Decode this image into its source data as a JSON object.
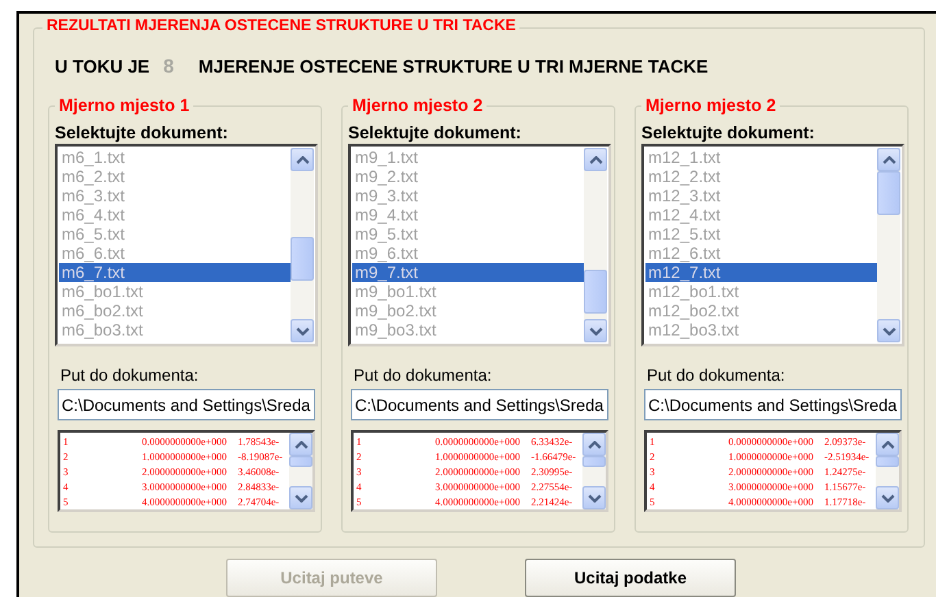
{
  "frame": {
    "title": "REZULTATI MJERENJA OSTECENE STRUKTURE U TRI TACKE"
  },
  "status": {
    "prefix": "U TOKU JE",
    "count": "8",
    "suffix": "MJERENJE OSTECENE STRUKTURE U TRI MJERNE TACKE"
  },
  "panels": [
    {
      "title": "Mjerno mjesto 1",
      "list_label": "Selektujte dokument:",
      "files": [
        {
          "label": "m6_1.txt",
          "selected": false
        },
        {
          "label": "m6_2.txt",
          "selected": false
        },
        {
          "label": "m6_3.txt",
          "selected": false
        },
        {
          "label": "m6_4.txt",
          "selected": false
        },
        {
          "label": "m6_5.txt",
          "selected": false
        },
        {
          "label": "m6_6.txt",
          "selected": false
        },
        {
          "label": "m6_7.txt",
          "selected": true
        },
        {
          "label": "m6_bo1.txt",
          "selected": false
        },
        {
          "label": "m6_bo2.txt",
          "selected": false
        },
        {
          "label": "m6_bo3.txt",
          "selected": false
        }
      ],
      "path_label": "Put do dokumenta:",
      "path": "C:\\Documents and Settings\\Sreda",
      "rows": [
        [
          "1",
          "0.0000000000e+000",
          "1.78543e-"
        ],
        [
          "2",
          "1.0000000000e+000",
          "-8.19087e-"
        ],
        [
          "3",
          "2.0000000000e+000",
          "3.46008e-"
        ],
        [
          "4",
          "3.0000000000e+000",
          "2.84833e-"
        ],
        [
          "5",
          "4.0000000000e+000",
          "2.74704e-"
        ]
      ]
    },
    {
      "title": "Mjerno mjesto 2",
      "list_label": "Selektujte dokument:",
      "files": [
        {
          "label": "m9_1.txt",
          "selected": false
        },
        {
          "label": "m9_2.txt",
          "selected": false
        },
        {
          "label": "m9_3.txt",
          "selected": false
        },
        {
          "label": "m9_4.txt",
          "selected": false
        },
        {
          "label": "m9_5.txt",
          "selected": false
        },
        {
          "label": "m9_6.txt",
          "selected": false
        },
        {
          "label": "m9_7.txt",
          "selected": true
        },
        {
          "label": "m9_bo1.txt",
          "selected": false
        },
        {
          "label": "m9_bo2.txt",
          "selected": false
        },
        {
          "label": "m9_bo3.txt",
          "selected": false
        }
      ],
      "path_label": "Put do dokumenta:",
      "path": "C:\\Documents and Settings\\Sreda",
      "rows": [
        [
          "1",
          "0.0000000000e+000",
          "6.33432e-"
        ],
        [
          "2",
          "1.0000000000e+000",
          "-1.66479e-"
        ],
        [
          "3",
          "2.0000000000e+000",
          "2.30995e-"
        ],
        [
          "4",
          "3.0000000000e+000",
          "2.27554e-"
        ],
        [
          "5",
          "4.0000000000e+000",
          "2.21424e-"
        ]
      ]
    },
    {
      "title": "Mjerno mjesto 2",
      "list_label": "Selektujte dokument:",
      "files": [
        {
          "label": "m12_1.txt",
          "selected": false
        },
        {
          "label": "m12_2.txt",
          "selected": false
        },
        {
          "label": "m12_3.txt",
          "selected": false
        },
        {
          "label": "m12_4.txt",
          "selected": false
        },
        {
          "label": "m12_5.txt",
          "selected": false
        },
        {
          "label": "m12_6.txt",
          "selected": false
        },
        {
          "label": "m12_7.txt",
          "selected": true
        },
        {
          "label": "m12_bo1.txt",
          "selected": false
        },
        {
          "label": "m12_bo2.txt",
          "selected": false
        },
        {
          "label": "m12_bo3.txt",
          "selected": false
        }
      ],
      "path_label": "Put do dokumenta:",
      "path": "C:\\Documents and Settings\\Sreda",
      "rows": [
        [
          "1",
          "0.0000000000e+000",
          "2.09373e-"
        ],
        [
          "2",
          "1.0000000000e+000",
          "-2.51934e-"
        ],
        [
          "3",
          "2.0000000000e+000",
          "1.24275e-"
        ],
        [
          "4",
          "3.0000000000e+000",
          "1.15677e-"
        ],
        [
          "5",
          "4.0000000000e+000",
          "1.17718e-"
        ]
      ]
    }
  ],
  "buttons": [
    {
      "label": "Ucitaj puteve",
      "disabled": true
    },
    {
      "label": "Ucitaj podatke",
      "disabled": false
    }
  ]
}
